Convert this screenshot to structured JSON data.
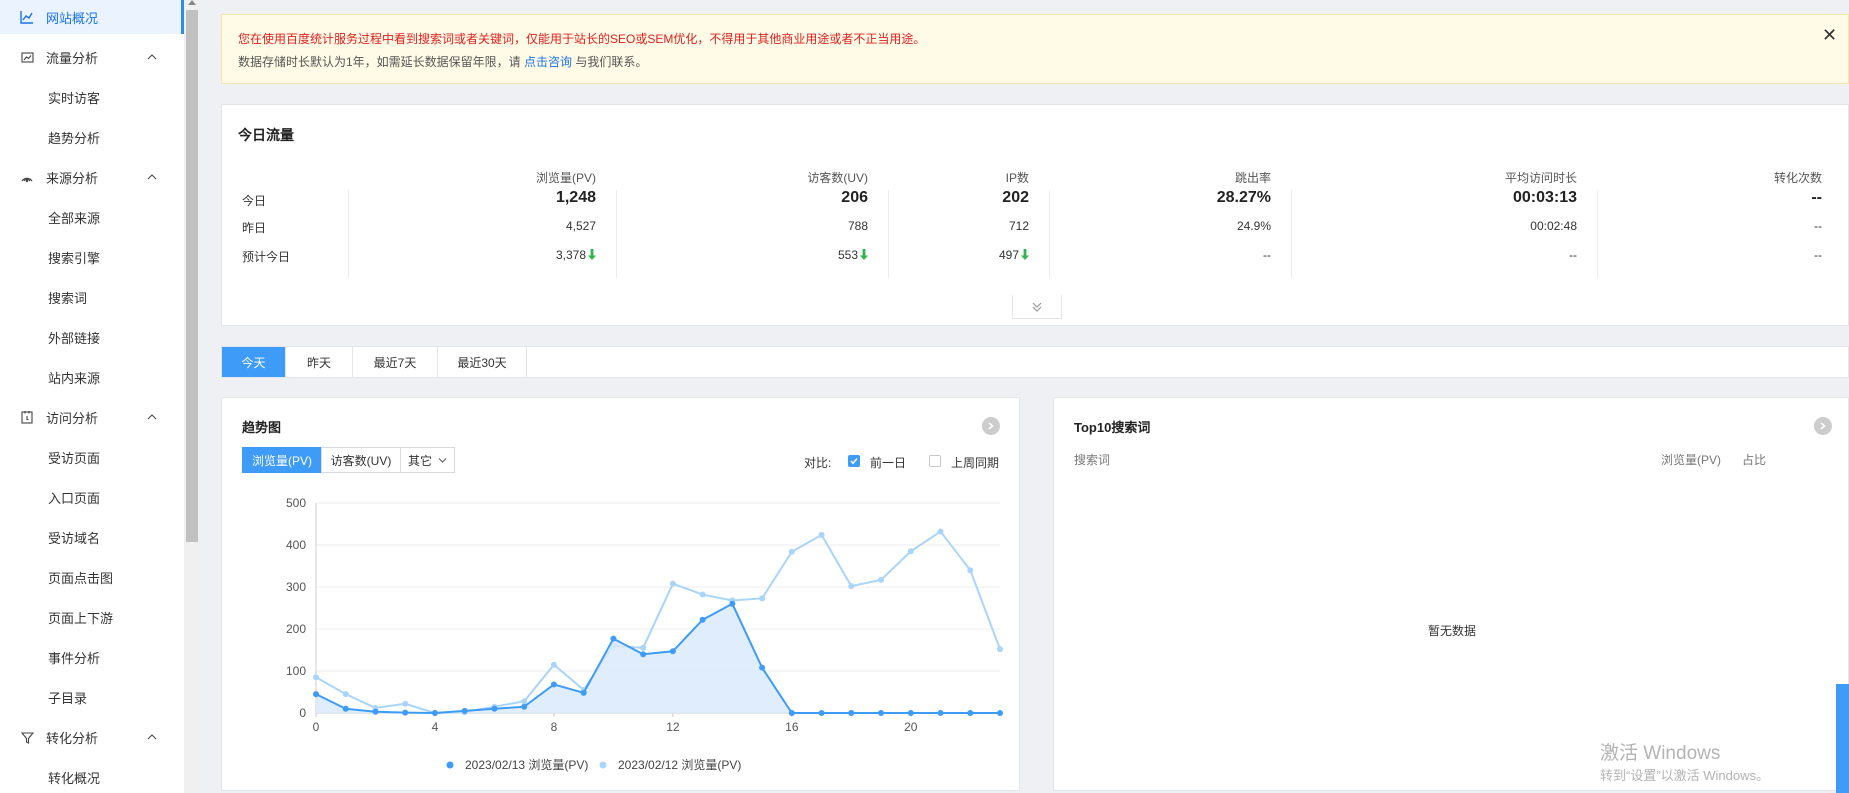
{
  "sidebar": {
    "overview": "网站概况",
    "groups": [
      {
        "label": "流量分析",
        "icon": "traffic-chart-icon",
        "items": [
          "实时访客",
          "趋势分析"
        ]
      },
      {
        "label": "来源分析",
        "icon": "signal-icon",
        "items": [
          "全部来源",
          "搜索引擎",
          "搜索词",
          "外部链接",
          "站内来源"
        ]
      },
      {
        "label": "访问分析",
        "icon": "page-visit-icon",
        "items": [
          "受访页面",
          "入口页面",
          "受访域名",
          "页面点击图",
          "页面上下游",
          "事件分析",
          "子目录"
        ]
      },
      {
        "label": "转化分析",
        "icon": "funnel-icon",
        "items": [
          "转化概况"
        ]
      }
    ]
  },
  "notice": {
    "line1": "您在使用百度统计服务过程中看到搜索词或者关键词，仅能用于站长的SEO或SEM优化，不得用于其他商业用途或者不正当用途。",
    "line2_prefix": "数据存储时长默认为1年，如需延长数据保留年限，请",
    "line2_link": "点击咨询",
    "line2_suffix": "与我们联系。",
    "close": "✕"
  },
  "today_traffic": {
    "title": "今日流量",
    "headers": [
      "浏览量(PV)",
      "访客数(UV)",
      "IP数",
      "跳出率",
      "平均访问时长",
      "转化次数"
    ],
    "rows": [
      {
        "label": "今日",
        "values": [
          "1,248",
          "206",
          "202",
          "28.27%",
          "00:03:13",
          "--"
        ]
      },
      {
        "label": "昨日",
        "values": [
          "4,527",
          "788",
          "712",
          "24.9%",
          "00:02:48",
          "--"
        ]
      },
      {
        "label": "预计今日",
        "values": [
          "3,378",
          "553",
          "497",
          "--",
          "--",
          "--"
        ]
      }
    ],
    "trend_down_color": "#2db84d"
  },
  "date_tabs": [
    "今天",
    "昨天",
    "最近7天",
    "最近30天"
  ],
  "trend": {
    "title": "趋势图",
    "metric_tabs": [
      "浏览量(PV)",
      "访客数(UV)",
      "其它"
    ],
    "compare_label": "对比:",
    "compare_options": [
      {
        "label": "前一日",
        "checked": true
      },
      {
        "label": "上周同期",
        "checked": false
      }
    ]
  },
  "top10": {
    "title": "Top10搜索词",
    "columns": [
      "搜索词",
      "浏览量(PV)",
      "占比"
    ],
    "empty": "暂无数据"
  },
  "chart_data": {
    "type": "line",
    "x": [
      0,
      1,
      2,
      3,
      4,
      5,
      6,
      7,
      8,
      9,
      10,
      11,
      12,
      13,
      14,
      15,
      16,
      17,
      18,
      19,
      20,
      21,
      22,
      23
    ],
    "x_ticks": [
      0,
      4,
      8,
      12,
      16,
      20
    ],
    "ylim": [
      0,
      500
    ],
    "y_ticks": [
      0,
      100,
      200,
      300,
      400,
      500
    ],
    "grid": true,
    "legend_position": "bottom",
    "series": [
      {
        "name": "2023/02/13 浏览量(PV)",
        "color": "#3e9bf7",
        "area": true,
        "values": [
          45,
          10,
          3,
          1,
          0,
          5,
          10,
          15,
          68,
          48,
          177,
          140,
          147,
          222,
          260,
          108,
          0,
          0,
          0,
          0,
          0,
          0,
          0,
          0
        ]
      },
      {
        "name": "2023/02/12 浏览量(PV)",
        "color": "#a9d4fb",
        "area": false,
        "values": [
          85,
          45,
          12,
          22,
          0,
          2,
          15,
          28,
          115,
          55,
          160,
          155,
          308,
          282,
          268,
          273,
          384,
          424,
          302,
          317,
          385,
          432,
          340,
          152
        ]
      }
    ]
  },
  "watermark": {
    "line1": "激活 Windows",
    "line2": "转到“设置”以激活 Windows。"
  }
}
